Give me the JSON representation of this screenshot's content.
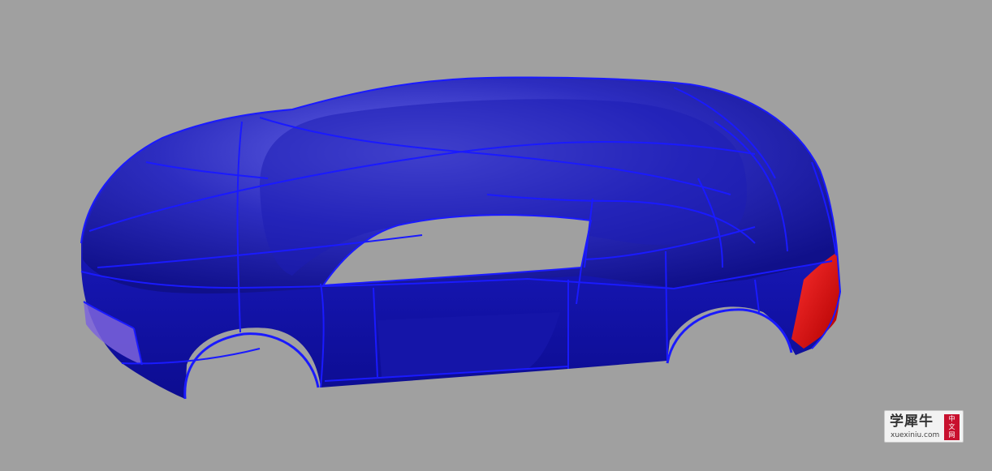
{
  "viewport": {
    "background_color": "#a0a0a0",
    "model_color": "#2222c8",
    "isocurve_color": "#1a1aff",
    "selected_color": "#e01010",
    "highlight_color": "#8a6ee0"
  },
  "watermark": {
    "title": "学犀牛",
    "url": "xuexiniu.com",
    "badge_chars": [
      "中",
      "文",
      "网"
    ],
    "badge_color": "#c8102e"
  }
}
